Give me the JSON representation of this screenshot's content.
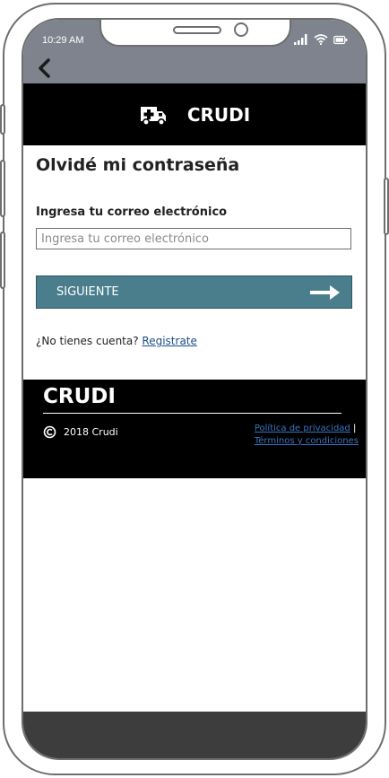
{
  "status_bar": {
    "time": "10:29 AM"
  },
  "header": {
    "brand": "CRUDI",
    "logo_icon": "ambulance-icon"
  },
  "form": {
    "title": "Olvidé mi contraseña",
    "email_label": "Ingresa tu correo electrónico",
    "email_placeholder": "Ingresa tu correo electrónico",
    "email_value": "",
    "submit_label": "SIGUIENTE"
  },
  "signup": {
    "prompt": "¿No tienes cuenta? ",
    "link_label": "Registrate"
  },
  "footer": {
    "brand": "CRUDI",
    "copyright": "2018 Crudi",
    "privacy_label": "Política de privacidad",
    "separator": " |",
    "terms_label": "Términos y condiciones"
  },
  "colors": {
    "accent": "#4a7e8c",
    "header_bg": "#000000",
    "status_bg": "#7e838d",
    "link": "#1a4f8a"
  }
}
